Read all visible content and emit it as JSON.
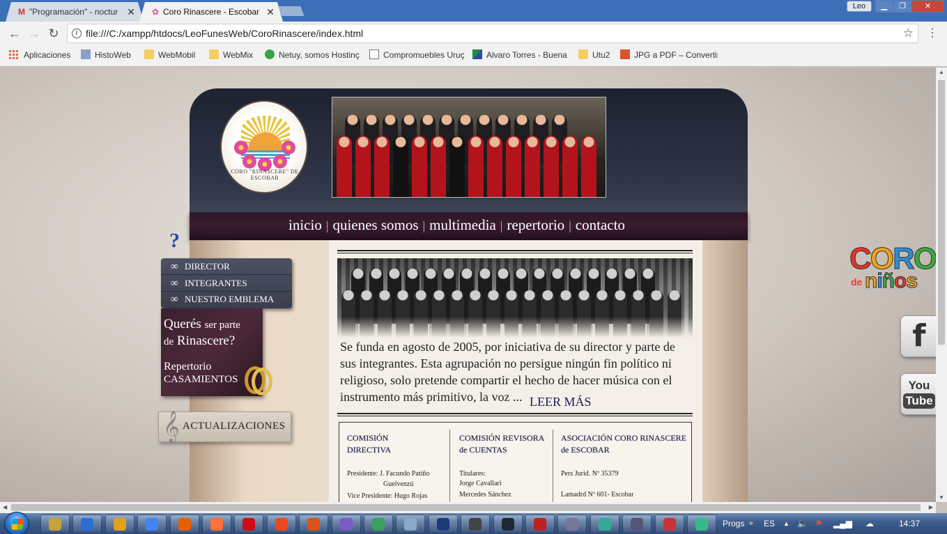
{
  "browser": {
    "tabs": [
      {
        "title": "\"Programación\" - noctur",
        "icon": "gmail-icon",
        "active": false
      },
      {
        "title": "Coro Rinascere - Escobar",
        "icon": "site-favicon",
        "active": true
      }
    ],
    "user_badge": "Leo",
    "url": "file:///C:/xampp/htdocs/LeoFunesWeb/CoroRinascere/index.html",
    "bookmarks": [
      {
        "label": "Aplicaciones",
        "icon": "apps-icon"
      },
      {
        "label": "HistoWeb",
        "icon": "bookmark-icon"
      },
      {
        "label": "WebMobil",
        "icon": "folder-icon"
      },
      {
        "label": "WebMix",
        "icon": "folder-icon"
      },
      {
        "label": "Netuy, somos Hostinç",
        "icon": "bookmark-icon"
      },
      {
        "label": "Compromuebles Uruç",
        "icon": "page-icon"
      },
      {
        "label": "Alvaro Torres - Buena",
        "icon": "bookmark-icon"
      },
      {
        "label": "Utu2",
        "icon": "folder-icon"
      },
      {
        "label": "JPG a PDF – Convertir",
        "icon": "pdf-icon"
      }
    ]
  },
  "site": {
    "logo_ring_text": "CORO \"RINASCERE\" DE ESCOBAR",
    "nav": [
      "inicio",
      "quienes somos",
      "multimedia",
      "repertorio",
      "contacto"
    ],
    "help_mark": "?",
    "side_menu": [
      "DIRECTOR",
      "INTEGRANTES",
      "NUESTRO EMBLEMA"
    ],
    "promo": {
      "q_big1": "Querés",
      "q_small1": "ser parte",
      "q_small2": "de",
      "q_big2": "Rinascere?",
      "r1": "Repertorio",
      "r2": "CASAMIENTOS"
    },
    "updates_label": "ACTUALIZACIONES",
    "intro_text": "Se funda en agosto de 2005, por iniciativa de su director y parte de sus integrantes. Esta agrupación no persigue ningún fin político ni religioso, solo pretende compartir el hecho de hacer música con el instrumento más primitivo, la voz ...",
    "read_more": "LEER MÁS",
    "info": {
      "col1_title": "COMISIÓN DIRECTIVA",
      "col1_lines": [
        "Presidente: J. Facundo Patiño",
        "Guelvenzú",
        "Vice Presidente: Hugo Rojas"
      ],
      "col2_title": "COMISIÓN REVISORA de CUENTAS",
      "col2_lines": [
        "Titulares:",
        "Jorge Cavallari",
        "Mercedes Sánchez"
      ],
      "col3_title": "ASOCIACIÓN CORO RINASCERE de ESCOBAR",
      "col3_lines": [
        "Pers Jurid. Nº 35379",
        "Lamadrd Nº 601- Escobar"
      ]
    },
    "kids_logo": {
      "coro": "CORO",
      "de": "de",
      "ninos": "niños"
    },
    "social": {
      "facebook": "f",
      "youtube_top": "You",
      "youtube_bottom": "Tube"
    }
  },
  "taskbar": {
    "tray_label": "Progs",
    "lang": "ES",
    "time": "14:37",
    "apps": [
      "explorer",
      "ie",
      "media-player",
      "chrome",
      "firefox-dev",
      "firefox",
      "opera",
      "ftp",
      "app",
      "app",
      "app",
      "app",
      "photoshop",
      "app",
      "steam",
      "filezilla",
      "app",
      "app",
      "app",
      "app",
      "app"
    ]
  },
  "colors": {
    "nav_bar": "#3a1c30",
    "link": "#1a1f57",
    "help_mark": "#2849a8",
    "gold": "#c79a2d"
  }
}
